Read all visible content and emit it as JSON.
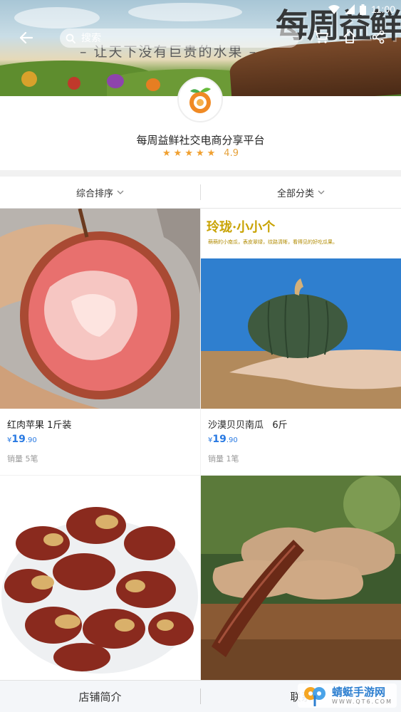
{
  "status_bar": {
    "time": "11:00"
  },
  "banner": {
    "slogan": "– 让天下没有巨贵的水果 –",
    "brand_text": "每周益鲜"
  },
  "search": {
    "placeholder": "搜索"
  },
  "shop": {
    "name": "每周益鲜社交电商分享平台",
    "rating": "4.9",
    "stars": 5
  },
  "filters": {
    "sort_label": "综合排序",
    "category_label": "全部分类"
  },
  "products": [
    {
      "title": "红肉苹果 1斤装",
      "currency": "¥",
      "price_int": "19",
      "price_dec": ".90",
      "sales": "销量 5笔"
    },
    {
      "title": "沙漠贝贝南瓜   6斤",
      "currency": "¥",
      "price_int": "19",
      "price_dec": ".90",
      "sales": "销量 1笔",
      "image_text": {
        "headline": "玲珑·小小个",
        "sub": "萌萌的小南瓜，表皮翠绿，纹路清晰，看得见的好吃瓜果。"
      }
    },
    {
      "title": "",
      "sales": ""
    },
    {
      "title": "",
      "sales": ""
    }
  ],
  "bottom_bar": {
    "intro_label": "店铺简介",
    "contact_label": "联系"
  },
  "watermark": {
    "name": "蜻蜓手游网",
    "url": "WWW.QT6.COM"
  },
  "colors": {
    "price_blue": "#2a7ae2",
    "star_orange": "#f0a030"
  }
}
